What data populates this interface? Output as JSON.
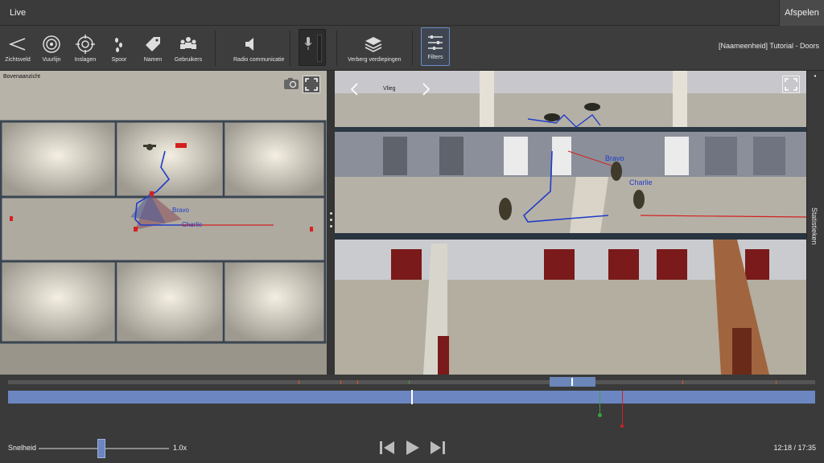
{
  "tabs": {
    "live": "Live",
    "afspelen": "Afspelen"
  },
  "toolbar": {
    "tools": [
      {
        "label": "Zichtsveld",
        "icon": "view-cone-icon"
      },
      {
        "label": "Vuurlijn",
        "icon": "target-icon"
      },
      {
        "label": "Inslagen",
        "icon": "impact-icon"
      },
      {
        "label": "Spoor",
        "icon": "footsteps-icon"
      },
      {
        "label": "Namen",
        "icon": "tag-icon"
      },
      {
        "label": "Gebruikers",
        "icon": "users-icon"
      },
      {
        "label": "Radio communicatie",
        "icon": "speaker-icon"
      },
      {
        "label": "Verberg verdiepingen",
        "icon": "layers-icon"
      },
      {
        "label": "Filters",
        "icon": "filters-icon"
      }
    ],
    "unit_title": "[Naameenheid] Tutorial - Doors"
  },
  "left_view": {
    "label": "Bovenaanzicht",
    "names": [
      "Bravo",
      "Charlie"
    ]
  },
  "right_view": {
    "label": "Vlieg",
    "names": [
      "Bravo",
      "Charlie"
    ]
  },
  "sidebar": {
    "statistics": "Statistieken"
  },
  "playback": {
    "speed_label": "Snelheid",
    "speed_value": "1.0x",
    "time": "12:18 / 17:35",
    "progress": 0.7
  },
  "colors": {
    "track": "#6b86c0",
    "accent": "#6a8fc7",
    "team_blue": "#1f3cc9",
    "enemy_red": "#d42020"
  }
}
